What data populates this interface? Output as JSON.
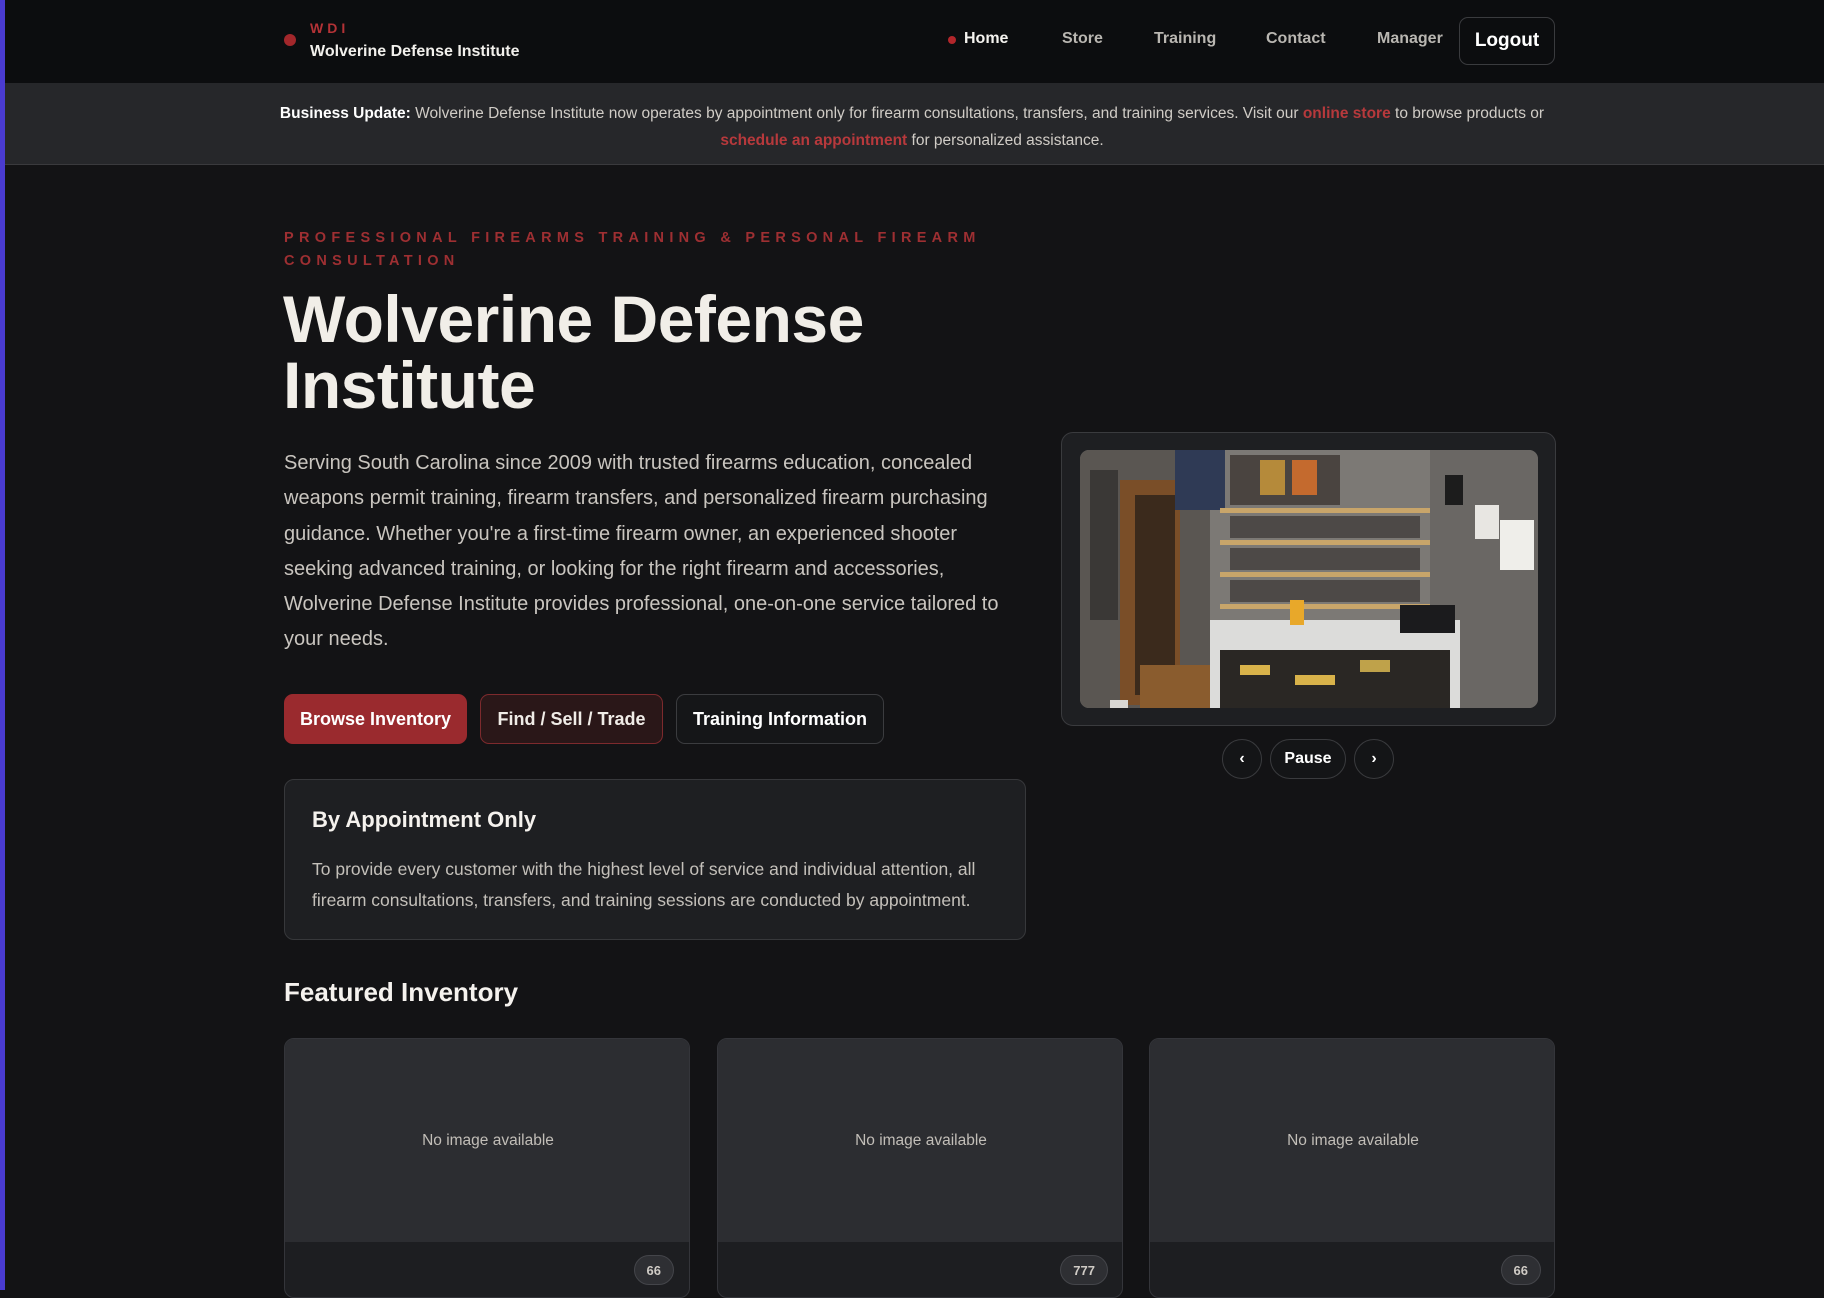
{
  "brand": {
    "abbr": "WDI",
    "name": "Wolverine Defense Institute"
  },
  "nav": {
    "items": [
      {
        "label": "Home",
        "active": true
      },
      {
        "label": "Store"
      },
      {
        "label": "Training"
      },
      {
        "label": "Contact"
      },
      {
        "label": "Manager"
      }
    ],
    "logout_label": "Logout"
  },
  "banner": {
    "lead": "Business Update:",
    "text_before": "Wolverine Defense Institute now operates by appointment only for firearm consultations, transfers, and training services. Visit our",
    "store_link": "online store",
    "text_middle": "to browse products or",
    "appt_link": "schedule an appointment",
    "text_after": "for personalized assistance."
  },
  "hero": {
    "eyebrow": "Professional Firearms Training & Personal Firearm Consultation",
    "title": "Wolverine Defense Institute",
    "description": "Serving South Carolina since 2009 with trusted firearms education, concealed weapons permit training, firearm transfers, and personalized firearm purchasing guidance. Whether you're a first-time firearm owner, an experienced shooter seeking advanced training, or looking for the right firearm and accessories, Wolverine Defense Institute provides professional, one-on-one service tailored to your needs.",
    "buttons": {
      "primary": "Browse Inventory",
      "secondary": "Find / Sell / Trade",
      "outline": "Training Information"
    }
  },
  "appointment": {
    "title": "By Appointment Only",
    "text": "To provide every customer with the highest level of service and individual attention, all firearm consultations, transfers, and training sessions are conducted by appointment."
  },
  "carousel": {
    "prev": "‹",
    "pause": "Pause",
    "next": "›"
  },
  "featured": {
    "title": "Featured Inventory",
    "cards": [
      {
        "placeholder": "No image available",
        "badge": "66"
      },
      {
        "placeholder": "No image available",
        "badge": "777"
      },
      {
        "placeholder": "No image available",
        "badge": "66"
      }
    ]
  },
  "colors": {
    "accent": "#9a2a2e",
    "background": "#131315",
    "nav_bg": "#0c0d0f",
    "banner_bg": "#26272a",
    "card_bg": "#1e1f22"
  }
}
